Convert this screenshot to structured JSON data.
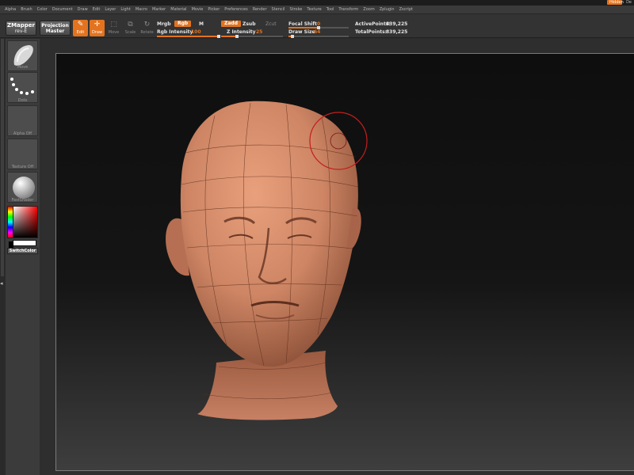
{
  "titlebar": {
    "accent_label": "Hidden",
    "right_label": "De"
  },
  "menu": [
    "Alpha",
    "Brush",
    "Color",
    "Document",
    "Draw",
    "Edit",
    "Layer",
    "Light",
    "Macro",
    "Marker",
    "Material",
    "Movie",
    "Picker",
    "Preferences",
    "Render",
    "Stencil",
    "Stroke",
    "Texture",
    "Tool",
    "Transform",
    "Zoom",
    "Zplugin",
    "Zscript"
  ],
  "toolbar": {
    "zmapper": {
      "line1": "ZMapper",
      "line2": "rev-E"
    },
    "projection": {
      "line1": "Projection",
      "line2": "Master"
    },
    "edit": "Edit",
    "draw": "Draw",
    "move": "Move",
    "scale": "Scale",
    "rotate": "Rotate",
    "mrgb": "Mrgb",
    "rgb": "Rgb",
    "m": "M",
    "rgb_intensity_label": "Rgb Intensity",
    "rgb_intensity_value": "100",
    "zadd": "Zadd",
    "zsub": "Zsub",
    "zcut": "Zcut",
    "z_intensity_label": "Z Intensity",
    "z_intensity_value": "25",
    "focal_shift_label": "Focal Shift",
    "focal_shift_value": "0",
    "draw_size_label": "Draw Size",
    "draw_size_value": "64",
    "active_points_label": "ActivePoints:",
    "active_points_value": "839,225",
    "total_points_label": "TotalPoints:",
    "total_points_value": "839,225"
  },
  "levels": {
    "rgb_intensity": 1.0,
    "z_intensity": 0.25,
    "focal_shift": 0.5,
    "draw_size": 0.06
  },
  "shelf": {
    "brush_label": "Move",
    "stroke_label": "Dots",
    "alpha_label": "Alpha Off",
    "texture_label": "Texture Off",
    "material_label": "FastShader",
    "switch_color": "SwitchColor"
  },
  "colors": {
    "accent": "#e3731f",
    "skin": "#d38a6a",
    "brush_ring": "#c41e1e"
  },
  "icons": {
    "edit": "edit-pencil-icon",
    "draw": "draw-crosshair-icon",
    "move": "move-icon",
    "scale": "scale-icon",
    "rotate": "rotate-icon"
  }
}
